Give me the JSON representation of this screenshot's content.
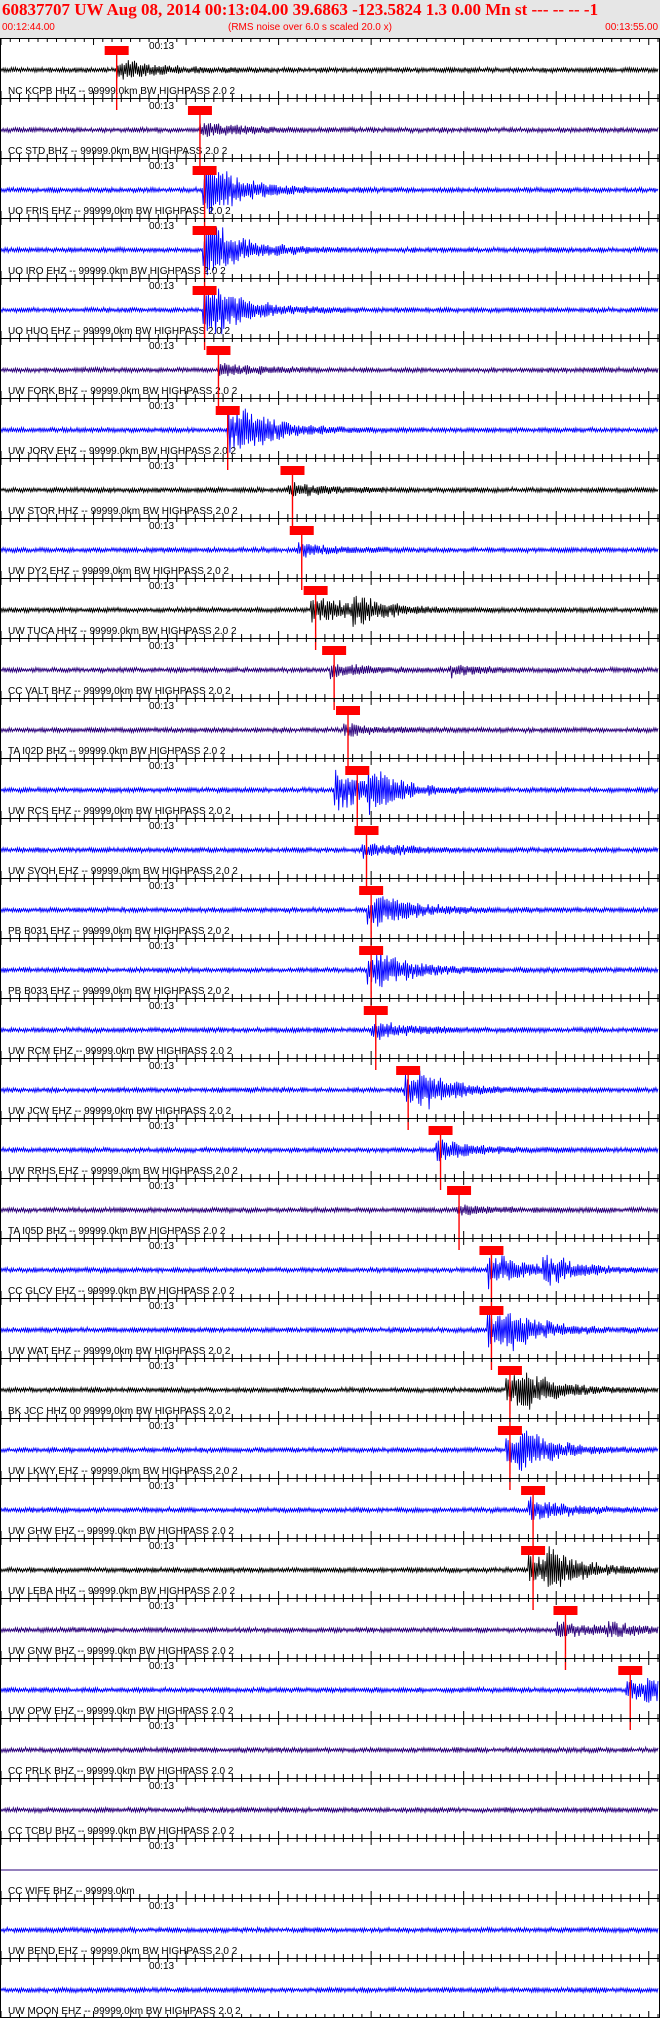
{
  "header": {
    "title": "60837707 UW Aug 08, 2014 00:13:04.00   39.6863 -123.5824  1.3 0.00 Mn st --- -- --   -1",
    "start_time": "00:12:44.00",
    "noise_note": "(RMS noise over 6.0 s scaled 20.0 x)",
    "end_time": "00:13:55.00"
  },
  "colors": {
    "blue": "#0000ff",
    "black": "#000000",
    "purple": "#2a007a",
    "pick_red": "#ff0000",
    "header_bg": "#e6e6e6"
  },
  "chart_data": {
    "type": "seismogram",
    "time_range": [
      "00:12:44.00",
      "00:13:55.00"
    ],
    "minute_marker": "00:13",
    "traces": [
      {
        "label": "NC KCPB HHZ -- 99999.0km BW  HIGHPASS  2.0  2",
        "color": "black",
        "pick_time": 12.5,
        "p_time": 12.5,
        "s_time": null,
        "arrival": null,
        "amp": 0.45
      },
      {
        "label": "CC STD BHZ -- 99999.0km BW  HIGHPASS  2.0  2",
        "color": "purple",
        "pick_time": 21.5,
        "p_time": 21.5,
        "s_time": null,
        "arrival": null,
        "amp": 0.35
      },
      {
        "label": "UO FRIS EHZ -- 99999.0km BW  HIGHPASS  2.0  2",
        "color": "blue",
        "pick_time": 22.0,
        "p_time": 21.8,
        "s_time": null,
        "arrival": 22.0,
        "amp": 0.9
      },
      {
        "label": "UO IRO EHZ -- 99999.0km BW  HIGHPASS  2.0  2",
        "color": "blue",
        "pick_time": 22.0,
        "p_time": 21.8,
        "s_time": null,
        "arrival": 22.0,
        "amp": 0.9
      },
      {
        "label": "UO HUO EHZ -- 99999.0km BW  HIGHPASS  2.0  2",
        "color": "blue",
        "pick_time": 22.0,
        "p_time": 21.8,
        "s_time": null,
        "arrival": 22.0,
        "amp": 0.9
      },
      {
        "label": "UW FORK BHZ -- 99999.0km BW  HIGHPASS  2.0  2",
        "color": "purple",
        "pick_time": 23.5,
        "p_time": 23.5,
        "s_time": null,
        "arrival": null,
        "amp": 0.3
      },
      {
        "label": "UW JORV EHZ -- 99999.0km BW  HIGHPASS  2.0  2",
        "color": "blue",
        "pick_time": 24.5,
        "p_time": 24.5,
        "s_time": null,
        "arrival": 25.5,
        "amp": 0.9
      },
      {
        "label": "UW STOR HHZ -- 99999.0km BW  HIGHPASS  2.0  2",
        "color": "black",
        "pick_time": 31.5,
        "p_time": 31.0,
        "s_time": null,
        "arrival": null,
        "amp": 0.3
      },
      {
        "label": "UW DY2 EHZ -- 99999.0km BW  HIGHPASS  2.0  2",
        "color": "blue",
        "pick_time": 32.5,
        "p_time": 32.0,
        "s_time": null,
        "arrival": null,
        "amp": 0.3
      },
      {
        "label": "UW TUCA HHZ -- 99999.0km BW  HIGHPASS  2.0  2",
        "color": "black",
        "pick_time": 34.0,
        "p_time": 33.5,
        "s_time": null,
        "arrival": 38.0,
        "amp": 0.7
      },
      {
        "label": "CC VALT BHZ -- 99999.0km BW  HIGHPASS  2.0  2",
        "color": "purple",
        "pick_time": 36.0,
        "p_time": 35.5,
        "s_time": null,
        "arrival": 48.5,
        "amp": 0.3
      },
      {
        "label": "TA I02D BHZ -- 99999.0km BW  HIGHPASS  2.0  2",
        "color": "purple",
        "pick_time": 37.5,
        "p_time": 37.0,
        "s_time": null,
        "arrival": null,
        "amp": 0.25
      },
      {
        "label": "UW RCS EHZ -- 99999.0km BW  HIGHPASS  2.0  2",
        "color": "blue",
        "pick_time": 38.5,
        "p_time": 36.0,
        "s_time": null,
        "arrival": 39.5,
        "amp": 0.95
      },
      {
        "label": "UW SVOH EHZ -- 99999.0km BW  HIGHPASS  2.0  2",
        "color": "blue",
        "pick_time": 39.5,
        "p_time": 39.0,
        "s_time": null,
        "arrival": null,
        "amp": 0.35
      },
      {
        "label": "PB B031 EHZ -- 99999.0km BW  HIGHPASS  2.0  2",
        "color": "blue",
        "pick_time": 40.0,
        "p_time": 39.5,
        "s_time": null,
        "arrival": 40.5,
        "amp": 0.6
      },
      {
        "label": "PB B033 EHZ -- 99999.0km BW  HIGHPASS  2.0  2",
        "color": "blue",
        "pick_time": 40.0,
        "p_time": 39.5,
        "s_time": null,
        "arrival": 40.5,
        "amp": 0.6
      },
      {
        "label": "UW RCM EHZ -- 99999.0km BW  HIGHPASS  2.0  2",
        "color": "blue",
        "pick_time": 40.5,
        "p_time": 40.0,
        "s_time": null,
        "arrival": null,
        "amp": 0.4
      },
      {
        "label": "UW JCW EHZ -- 99999.0km BW  HIGHPASS  2.0  2",
        "color": "blue",
        "pick_time": 44.0,
        "p_time": 43.5,
        "s_time": null,
        "arrival": 45.0,
        "amp": 0.7
      },
      {
        "label": "UW RRHS EHZ -- 99999.0km BW  HIGHPASS  2.0  2",
        "color": "blue",
        "pick_time": 47.5,
        "p_time": 47.0,
        "s_time": null,
        "arrival": null,
        "amp": 0.5
      },
      {
        "label": "TA I05D BHZ -- 99999.0km BW  HIGHPASS  2.0  2",
        "color": "purple",
        "pick_time": 49.5,
        "p_time": 49.0,
        "s_time": null,
        "arrival": null,
        "amp": 0.25
      },
      {
        "label": "CC GLCV EHZ -- 99999.0km BW  HIGHPASS  2.0  2",
        "color": "blue",
        "pick_time": 53.0,
        "p_time": 52.5,
        "s_time": null,
        "arrival": 58.5,
        "amp": 0.8
      },
      {
        "label": "UW WAT EHZ -- 99999.0km BW  HIGHPASS  2.0  2",
        "color": "blue",
        "pick_time": 53.0,
        "p_time": 52.5,
        "s_time": null,
        "arrival": 54.5,
        "amp": 0.85
      },
      {
        "label": "BK JCC HHZ 00 99999.0km BW  HIGHPASS  2.0  2",
        "color": "black",
        "pick_time": 55.0,
        "p_time": 54.5,
        "s_time": null,
        "arrival": 56.0,
        "amp": 0.75
      },
      {
        "label": "UW LKWY EHZ -- 99999.0km BW  HIGHPASS  2.0  2",
        "color": "blue",
        "pick_time": 55.0,
        "p_time": 54.5,
        "s_time": null,
        "arrival": 56.0,
        "amp": 0.7
      },
      {
        "label": "UW GHW EHZ -- 99999.0km BW  HIGHPASS  2.0  2",
        "color": "blue",
        "pick_time": 57.5,
        "p_time": 57.0,
        "s_time": null,
        "arrival": null,
        "amp": 0.55
      },
      {
        "label": "UW LEBA HHZ -- 99999.0km BW  HIGHPASS  2.0  2",
        "color": "black",
        "pick_time": 57.5,
        "p_time": 57.0,
        "s_time": null,
        "arrival": 59.0,
        "amp": 0.75
      },
      {
        "label": "UW GNW BHZ -- 99999.0km BW  HIGHPASS  2.0  2",
        "color": "purple",
        "pick_time": 61.0,
        "p_time": 60.0,
        "s_time": null,
        "arrival": 65.5,
        "amp": 0.35
      },
      {
        "label": "UW OPW EHZ -- 99999.0km BW  HIGHPASS  2.0  2",
        "color": "blue",
        "pick_time": 68.0,
        "p_time": 67.5,
        "s_time": null,
        "arrival": 69.5,
        "amp": 0.5
      },
      {
        "label": "CC PRLK BHZ -- 99999.0km BW  HIGHPASS  2.0  2",
        "color": "purple",
        "pick_time": null,
        "p_time": null,
        "s_time": null,
        "arrival": null,
        "amp": 0.2
      },
      {
        "label": "CC TCBU BHZ -- 99999.0km BW  HIGHPASS  2.0  2",
        "color": "purple",
        "pick_time": null,
        "p_time": null,
        "s_time": null,
        "arrival": null,
        "amp": 0.2
      },
      {
        "label": "CC WIFE BHZ -- 99999.0km",
        "color": "purple",
        "pick_time": null,
        "p_time": null,
        "s_time": null,
        "arrival": null,
        "amp": 0.0
      },
      {
        "label": "UW BEND EHZ -- 99999.0km BW  HIGHPASS  2.0  2",
        "color": "blue",
        "pick_time": null,
        "p_time": null,
        "s_time": null,
        "arrival": null,
        "amp": 0.35
      },
      {
        "label": "UW MOON EHZ -- 99999.0km BW  HIGHPASS  2.0  2",
        "color": "blue",
        "pick_time": null,
        "p_time": null,
        "s_time": null,
        "arrival": null,
        "amp": 0.35
      }
    ]
  }
}
